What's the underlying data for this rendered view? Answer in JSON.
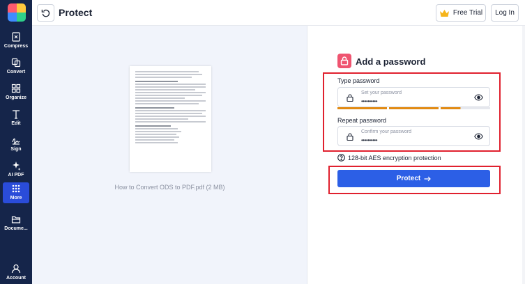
{
  "header": {
    "title": "Protect",
    "free_trial_label": "Free Trial",
    "login_label": "Log In"
  },
  "sidebar": {
    "items": [
      {
        "label": "Compress",
        "icon": "compress-icon"
      },
      {
        "label": "Convert",
        "icon": "convert-icon"
      },
      {
        "label": "Organize",
        "icon": "organize-icon"
      },
      {
        "label": "Edit",
        "icon": "edit-icon"
      },
      {
        "label": "Sign",
        "icon": "sign-icon"
      },
      {
        "label": "AI PDF",
        "icon": "sparkle-icon"
      },
      {
        "label": "More",
        "icon": "grid-icon"
      },
      {
        "label": "Docume...",
        "icon": "folder-icon"
      },
      {
        "label": "Account",
        "icon": "user-icon"
      }
    ]
  },
  "preview": {
    "file_label": "How to Convert ODS to PDF.pdf (2 MB)"
  },
  "panel": {
    "title": "Add a password",
    "type_label": "Type password",
    "type_placeholder": "Set your password",
    "type_value": "••••••••••",
    "repeat_label": "Repeat password",
    "repeat_placeholder": "Confirm your password",
    "repeat_value": "••••••••••",
    "aes_text": "128-bit AES encryption protection",
    "protect_label": "Protect"
  },
  "colors": {
    "sidebar_bg": "#15254a",
    "active_item": "#2a4cd9",
    "primary_button": "#2c5fe6",
    "lock_badge": "#ef5470",
    "highlight_box": "#e0202e",
    "strength_bar": "#e28a12"
  }
}
